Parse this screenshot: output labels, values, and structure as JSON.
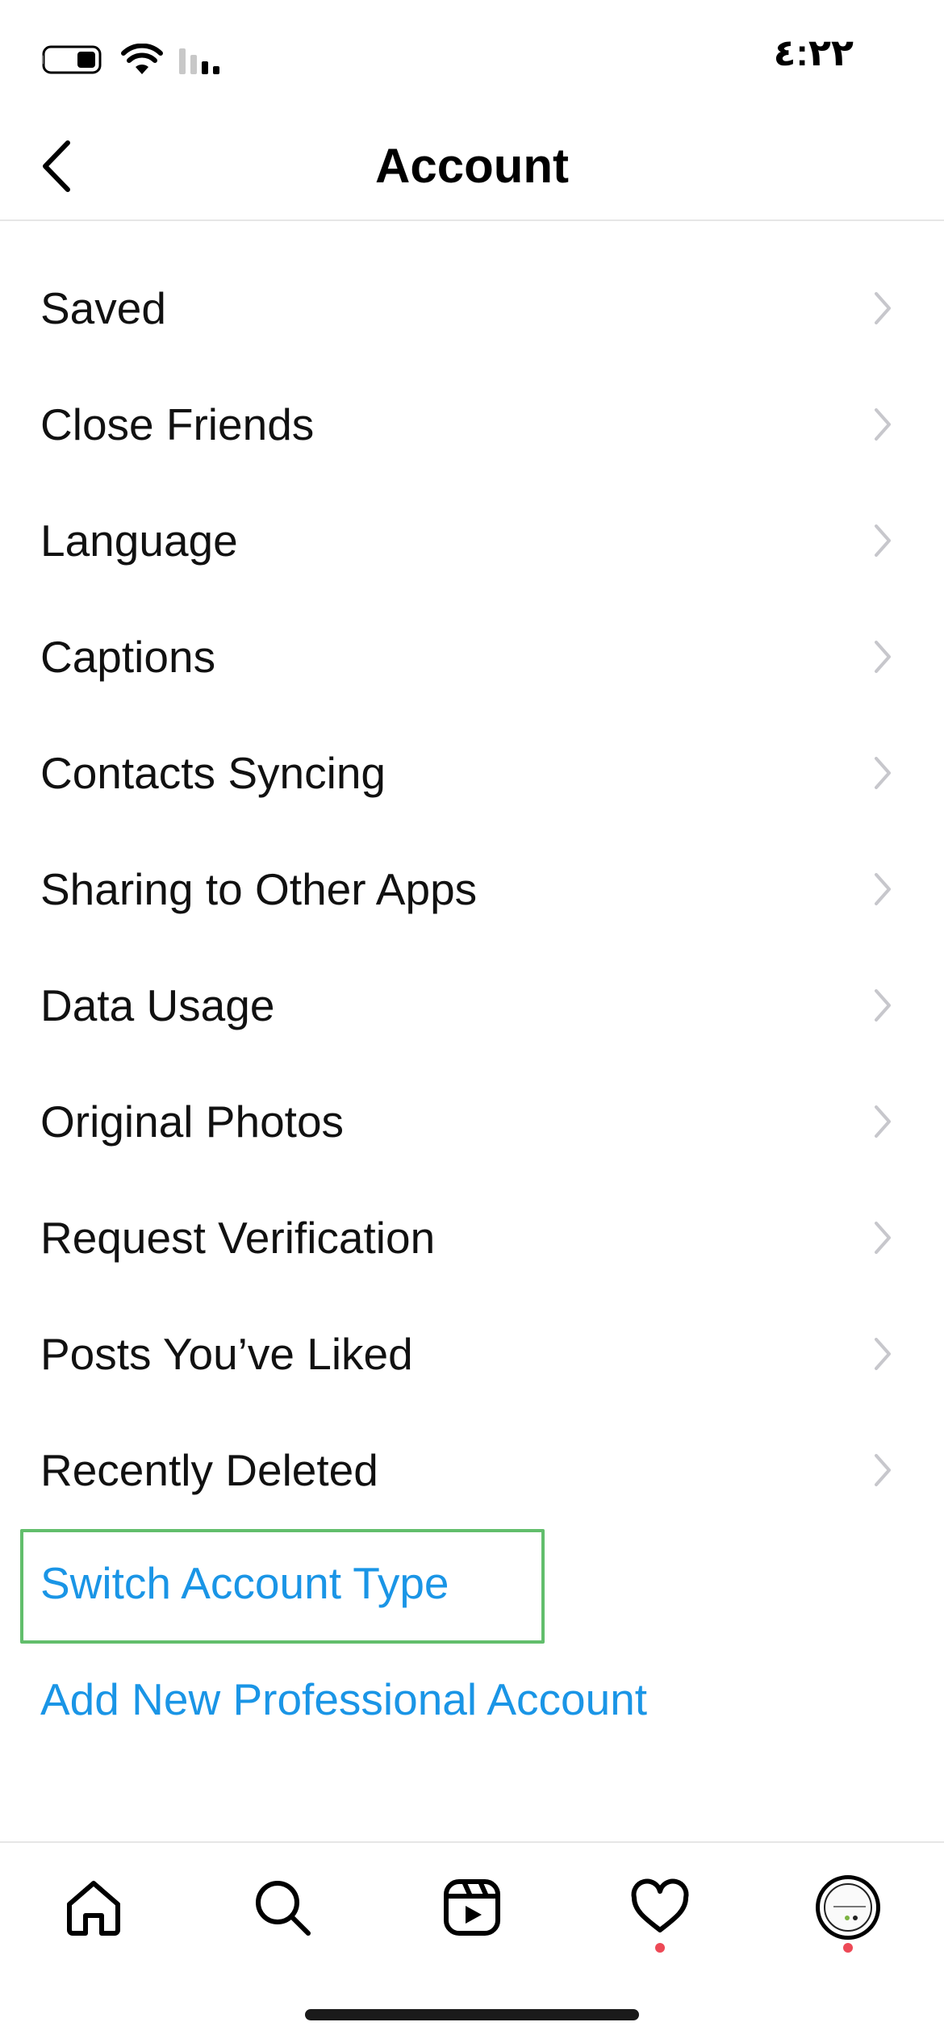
{
  "status_bar": {
    "time": "٤:٢٢",
    "battery_icon": "battery-icon",
    "wifi_icon": "wifi-icon",
    "signal_icon": "signal-icon"
  },
  "header": {
    "title": "Account",
    "back_icon": "chevron-left-icon"
  },
  "menu": {
    "items": [
      {
        "label": "Saved"
      },
      {
        "label": "Close Friends"
      },
      {
        "label": "Language"
      },
      {
        "label": "Captions"
      },
      {
        "label": "Contacts Syncing"
      },
      {
        "label": "Sharing to Other Apps"
      },
      {
        "label": "Data Usage"
      },
      {
        "label": "Original Photos"
      },
      {
        "label": "Request Verification"
      },
      {
        "label": "Posts You’ve Liked"
      },
      {
        "label": "Recently Deleted"
      }
    ],
    "chevron_icon": "chevron-right-icon"
  },
  "links": {
    "switch_account_type": "Switch Account Type",
    "add_professional_account": "Add New Professional Account"
  },
  "tab_bar": {
    "tabs": [
      "home-icon",
      "search-icon",
      "reels-icon",
      "heart-icon",
      "profile-avatar"
    ],
    "notification_dots": [
      "heart-icon",
      "profile-avatar"
    ]
  },
  "colors": {
    "link": "#1a95e6",
    "highlight": "#62be6c",
    "notification": "#ed4956",
    "chevron": "#c7c7cc"
  }
}
